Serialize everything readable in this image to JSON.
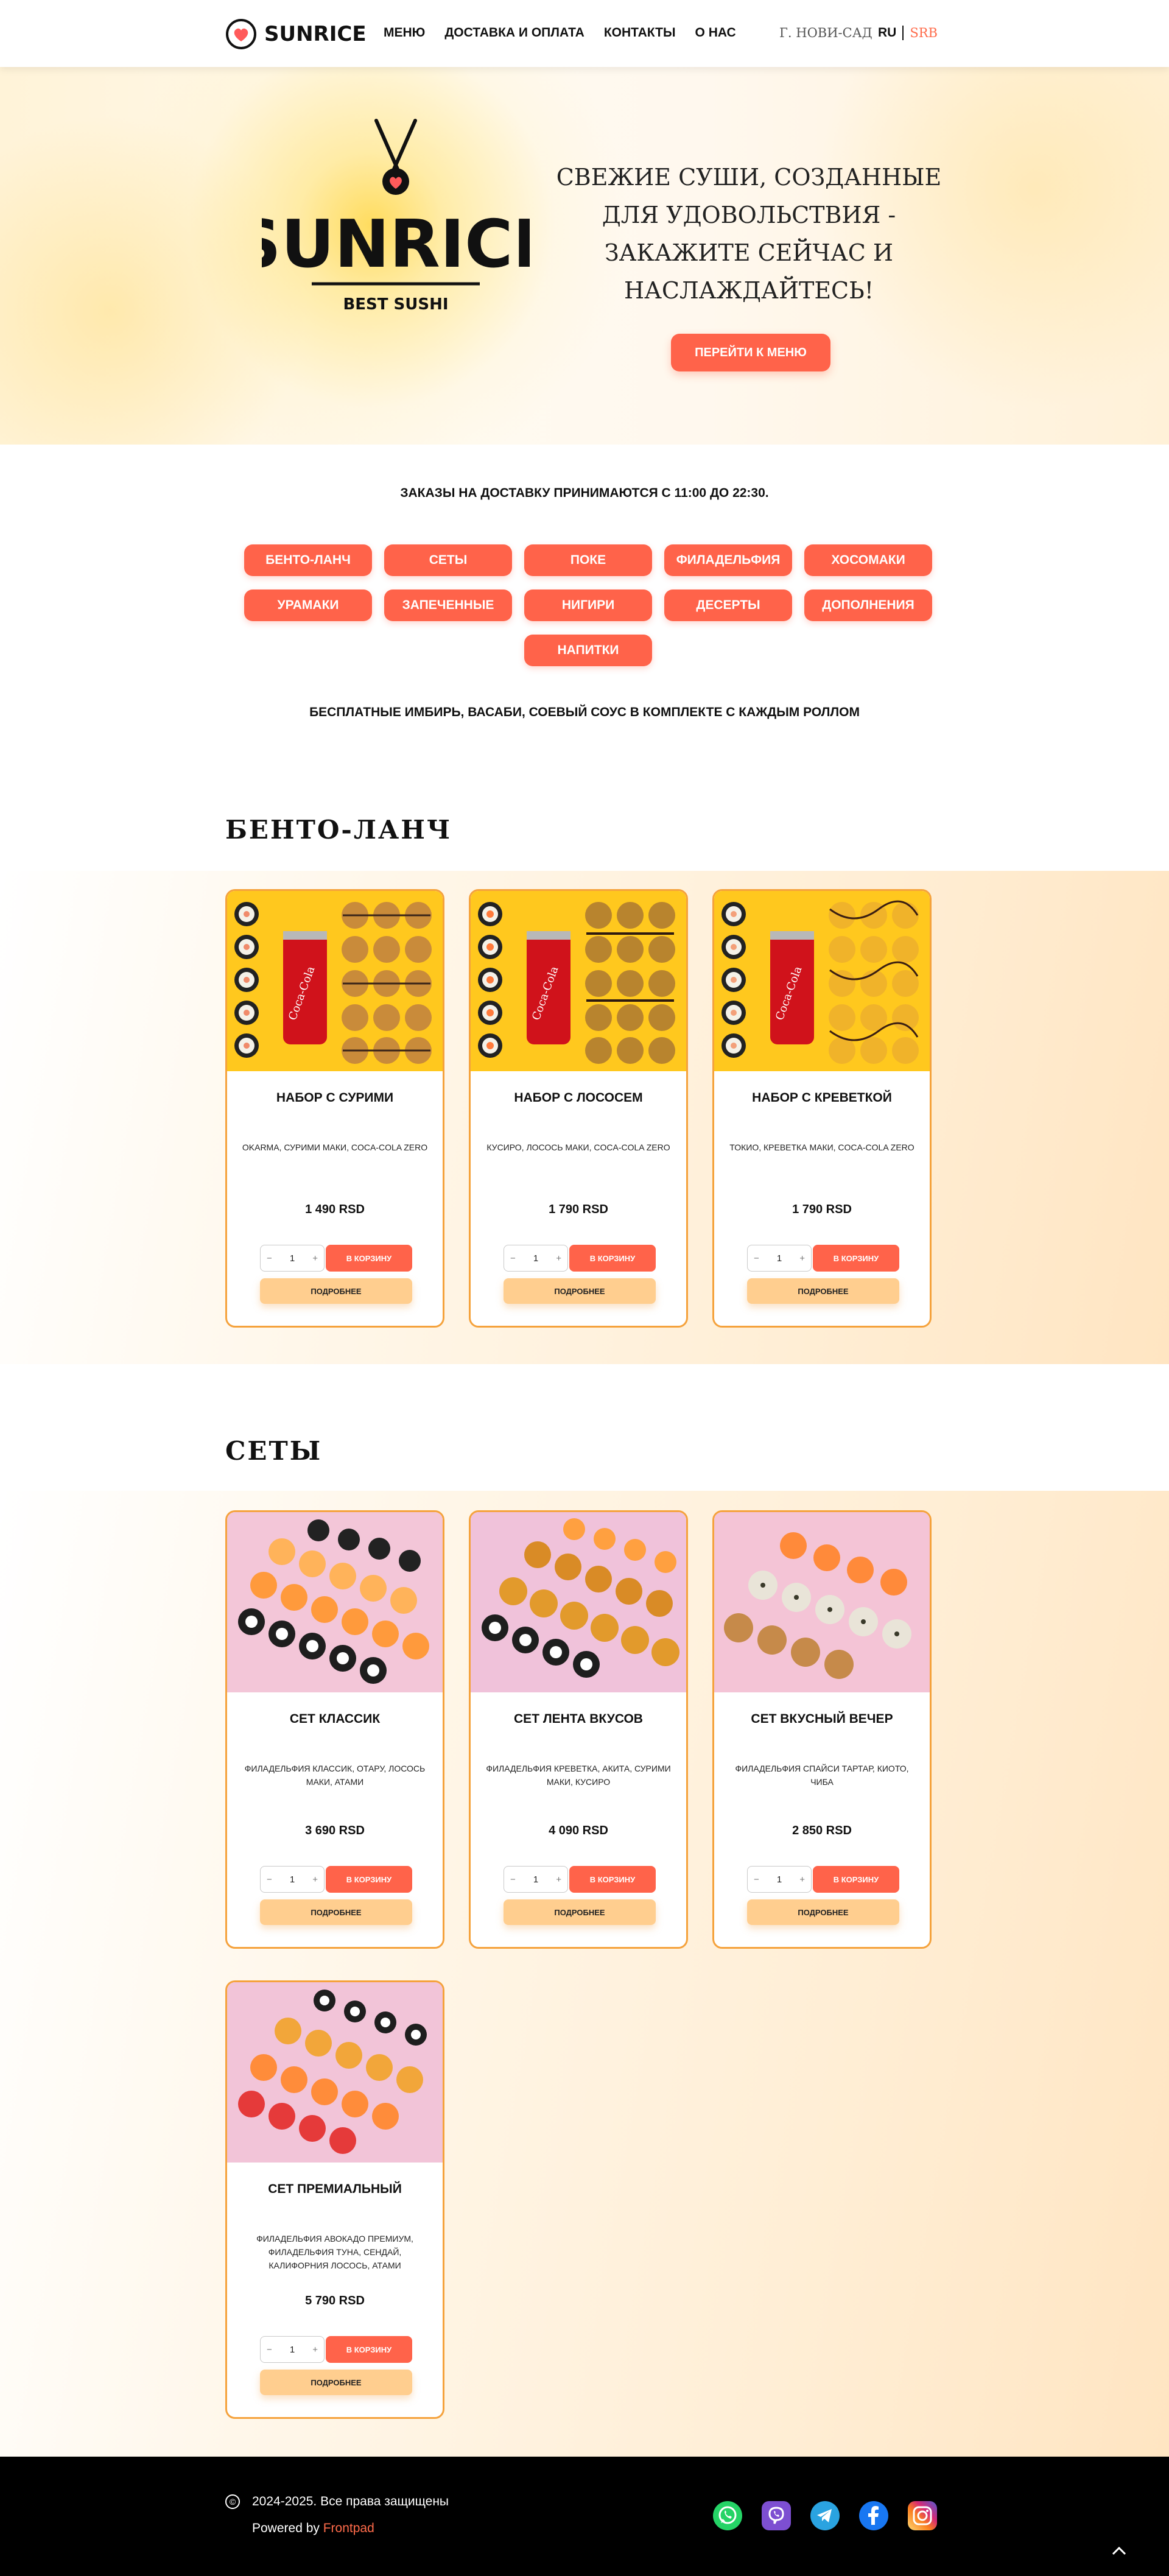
{
  "header": {
    "logo_text": "SUNRICE",
    "nav": [
      "МЕНЮ",
      "ДОСТАВКА И ОПЛАТА",
      "КОНТАКТЫ",
      "О НАС"
    ],
    "city": "Г. НОВИ-САД",
    "lang_ru": "RU",
    "lang_srb": "SRB"
  },
  "hero": {
    "logo_word": "SUNRICE",
    "logo_sub": "BEST SUSHI",
    "title": "СВЕЖИЕ СУШИ, СОЗДАННЫЕ ДЛЯ УДОВОЛЬСТВИЯ - ЗАКАЖИТЕ СЕЙЧАС И НАСЛАЖДАЙТЕСЬ!",
    "button": "ПЕРЕЙТИ К МЕНЮ"
  },
  "delivery_text": "ЗАКАЗЫ НА ДОСТАВКУ ПРИНИМАЮТСЯ С 11:00 ДО 22:30.",
  "categories": [
    "БЕНТО-ЛАНЧ",
    "СЕТЫ",
    "ПОКЕ",
    "ФИЛАДЕЛЬФИЯ",
    "ХОСОМАКИ",
    "УРАМАКИ",
    "ЗАПЕЧЕННЫЕ",
    "НИГИРИ",
    "ДЕСЕРТЫ",
    "ДОПОЛНЕНИЯ",
    "НАПИТКИ"
  ],
  "free_text": "БЕСПЛАТНЫЕ ИМБИРЬ, ВАСАБИ, СОЕВЫЙ СОУС В КОМПЛЕКТЕ С КАЖДЫМ РОЛЛОМ",
  "sections": [
    {
      "title": "БЕНТО-ЛАНЧ",
      "products": [
        {
          "name": "НАБОР С СУРИМИ",
          "desc": "OKARMA, СУРИМИ МАКИ, COCA-COLA ZERO",
          "price": "1 490 RSD",
          "qty": "1"
        },
        {
          "name": "НАБОР С ЛОСОСЕМ",
          "desc": "КУСИРО, ЛОСОСЬ МАКИ, COCA-COLA ZERO",
          "price": "1 790 RSD",
          "qty": "1"
        },
        {
          "name": "НАБОР С КРЕВЕТКОЙ",
          "desc": "ТОКИО, КРЕВЕТКА МАКИ, COCA-COLA ZERO",
          "price": "1 790 RSD",
          "qty": "1"
        }
      ]
    },
    {
      "title": "СЕТЫ",
      "products": [
        {
          "name": "СЕТ КЛАССИК",
          "desc": "ФИЛАДЕЛЬФИЯ КЛАССИК, ОТАРУ, ЛОСОСЬ МАКИ, АТАМИ",
          "price": "3 690 RSD",
          "qty": "1"
        },
        {
          "name": "СЕТ ЛЕНТА ВКУСОВ",
          "desc": "ФИЛАДЕЛЬФИЯ КРЕВЕТКА, АКИТА, СУРИМИ МАКИ, КУСИРО",
          "price": "4 090 RSD",
          "qty": "1"
        },
        {
          "name": "СЕТ ВКУСНЫЙ ВЕЧЕР",
          "desc": "ФИЛАДЕЛЬФИЯ СПАЙСИ ТАРТАР, КИОТО, ЧИБА",
          "price": "2 850 RSD",
          "qty": "1"
        },
        {
          "name": "СЕТ ПРЕМИАЛЬНЫЙ",
          "desc": "ФИЛАДЕЛЬФИЯ АВОКАДО ПРЕМИУМ, ФИЛАДЕЛЬФИЯ ТУНА, СЕНДАЙ, КАЛИФОРНИЯ ЛОСОСЬ, АТАМИ",
          "price": "5 790 RSD",
          "qty": "1"
        }
      ]
    }
  ],
  "labels": {
    "add": "В КОРЗИНУ",
    "more": "ПОДРОБНЕЕ",
    "minus": "−",
    "plus": "+"
  },
  "footer": {
    "copy_symbol": "©",
    "copyright": "2024-2025. Все права защищены",
    "powered_prefix": "Powered by ",
    "powered_brand": "Frontpad"
  },
  "socials": [
    "whatsapp-icon",
    "viber-icon",
    "telegram-icon",
    "facebook-icon",
    "instagram-icon"
  ],
  "colors": {
    "accent": "#ff634a",
    "card_border": "#f5a23c",
    "more_button": "#ffce8f",
    "footer": "#000000"
  }
}
